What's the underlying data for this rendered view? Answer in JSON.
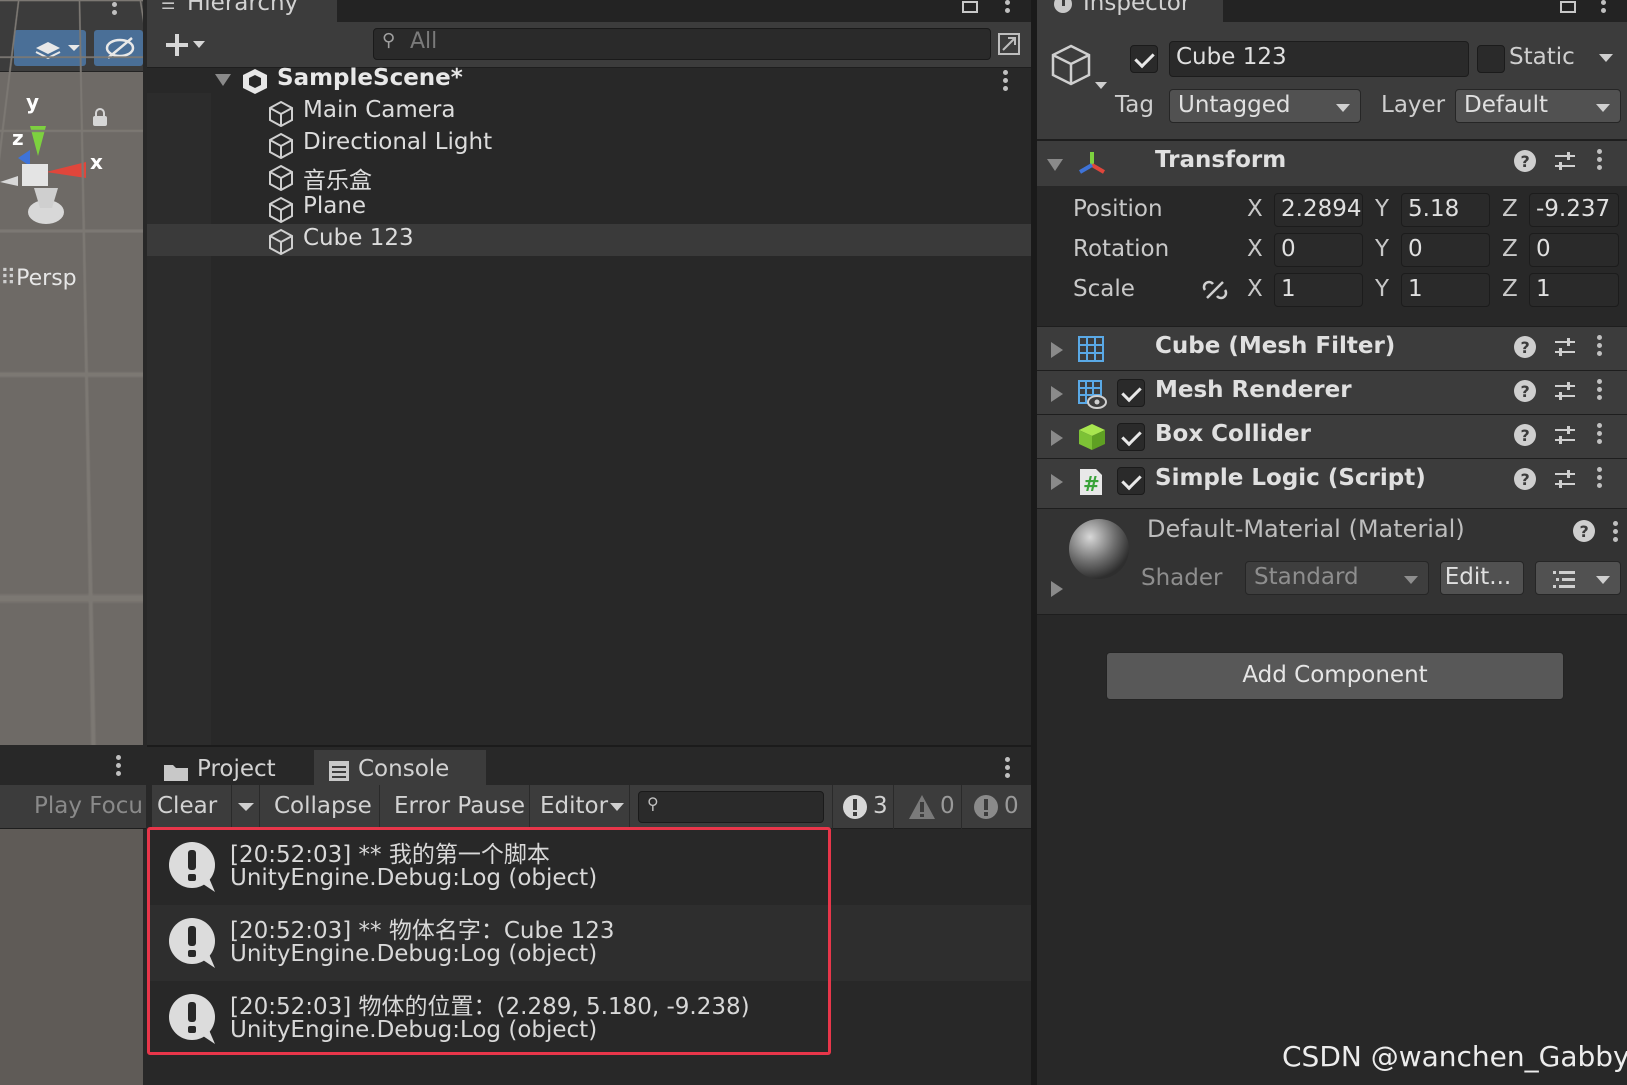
{
  "hierarchy": {
    "tab_title": "Hierarchy",
    "search_placeholder": "All",
    "scene_name": "SampleScene*",
    "items": [
      "Main Camera",
      "Directional Light",
      "音乐盒",
      "Plane",
      "Cube 123"
    ]
  },
  "scene_view": {
    "projection_label": "Persp",
    "axis_y": "y",
    "axis_x": "x",
    "axis_z": "z"
  },
  "console": {
    "tabs": [
      {
        "label": "Project",
        "icon": "folder-icon"
      },
      {
        "label": "Console",
        "icon": "console-icon"
      }
    ],
    "left_toolbar_label": "Play Focu",
    "toolbar": {
      "clear": "Clear",
      "collapse": "Collapse",
      "error_pause": "Error Pause",
      "editor": "Editor"
    },
    "counts": {
      "info": "3",
      "warnings": "0",
      "errors": "0"
    },
    "entries": [
      {
        "line1": "[20:52:03] ** 我的第一个脚本",
        "line2": "UnityEngine.Debug:Log (object)"
      },
      {
        "line1": "[20:52:03] ** 物体名字：Cube 123",
        "line2": "UnityEngine.Debug:Log (object)"
      },
      {
        "line1": "[20:52:03] 物体的位置：(2.289, 5.180, -9.238)",
        "line2": "UnityEngine.Debug:Log (object)"
      }
    ],
    "highlight_color": "#e8364a"
  },
  "inspector": {
    "tab_title": "Inspector",
    "object_name": "Cube 123",
    "static_label": "Static",
    "tag_label": "Tag",
    "tag_value": "Untagged",
    "layer_label": "Layer",
    "layer_value": "Default",
    "transform": {
      "title": "Transform",
      "position_label": "Position",
      "rotation_label": "Rotation",
      "scale_label": "Scale",
      "position": {
        "x": "2.2894",
        "y": "5.18",
        "z": "-9.237"
      },
      "rotation": {
        "x": "0",
        "y": "0",
        "z": "0"
      },
      "scale": {
        "x": "1",
        "y": "1",
        "z": "1"
      }
    },
    "axis_labels": {
      "x": "X",
      "y": "Y",
      "z": "Z"
    },
    "components": [
      {
        "name": "Cube (Mesh Filter)",
        "icon": "mesh-filter-icon",
        "has_checkbox": false
      },
      {
        "name": "Mesh Renderer",
        "icon": "mesh-renderer-icon",
        "has_checkbox": true
      },
      {
        "name": "Box Collider",
        "icon": "box-collider-icon",
        "has_checkbox": true
      },
      {
        "name": "Simple Logic (Script)",
        "icon": "script-icon",
        "has_checkbox": true
      }
    ],
    "material": {
      "name": "Default-Material (Material)",
      "shader_label": "Shader",
      "shader_value": "Standard",
      "edit_label": "Edit..."
    },
    "add_component": "Add Component"
  },
  "watermark": "CSDN @wanchen_Gabby"
}
